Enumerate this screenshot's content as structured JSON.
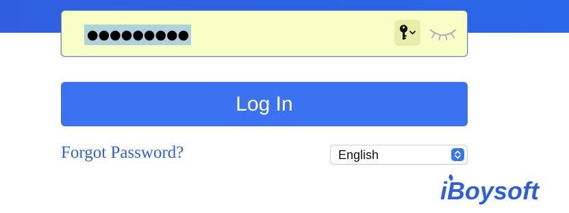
{
  "login_form": {
    "password": {
      "masked_value": "●●●●●●●●●",
      "selected": true
    },
    "keychain_icon": "key-icon",
    "toggle_visibility_icon": "eye-closed-icon",
    "login_label": "Log In",
    "forgot_password_label": "Forgot Password?",
    "language": {
      "selected": "English"
    }
  },
  "branding": {
    "logo_text": "iBoysoft"
  },
  "colors": {
    "header_blue": "#2f5fe0",
    "field_fill": "#f7ffc6",
    "selection_highlight": "#aed2dc",
    "button_blue": "#3a72f2",
    "link_blue": "#2b63d9",
    "select_accent": "#3478f6"
  }
}
